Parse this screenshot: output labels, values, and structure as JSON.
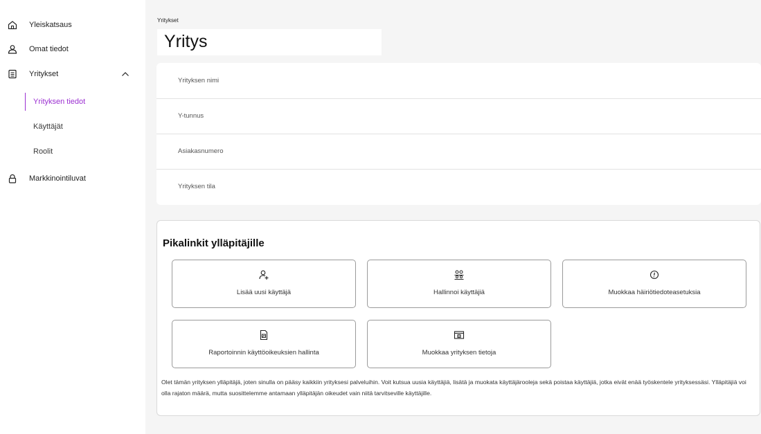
{
  "sidebar": {
    "items": [
      {
        "label": "Yleiskatsaus",
        "icon": "home-icon"
      },
      {
        "label": "Omat tiedot",
        "icon": "user-icon"
      },
      {
        "label": "Yritykset",
        "icon": "document-icon"
      },
      {
        "label": "Markkinointiluvat",
        "icon": "lock-icon"
      }
    ],
    "subitems": [
      {
        "label": "Yrityksen tiedot",
        "active": true
      },
      {
        "label": "Käyttäjät"
      },
      {
        "label": "Roolit"
      }
    ]
  },
  "breadcrumb": "Yritykset",
  "page_title": "Yritys",
  "fields": [
    {
      "label": "Yrityksen nimi"
    },
    {
      "label": "Y-tunnus"
    },
    {
      "label": "Asiakasnumero"
    },
    {
      "label": "Yrityksen tila"
    }
  ],
  "quick_links": {
    "title": "Pikalinkit ylläpitäjille",
    "buttons": [
      {
        "label": "Lisää uusi käyttäjä",
        "icon": "add-user-icon"
      },
      {
        "label": "Hallinnoi käyttäjiä",
        "icon": "users-icon"
      },
      {
        "label": "Muokkaa häiriötiedoteasetuksia",
        "icon": "alert-icon"
      },
      {
        "label": "Raportoinnin käyttöoikeuksien hallinta",
        "icon": "report-icon"
      },
      {
        "label": "Muokkaa yrityksen tietoja",
        "icon": "company-card-icon"
      }
    ],
    "description": "Olet tämän yrityksen ylläpitäjä, joten sinulla on pääsy kaikkiin yrityksesi palveluihin. Voit kutsua uusia käyttäjiä, lisätä ja muokata käyttäjärooleja sekä poistaa käyttäjiä, jotka eivät enää työskentele yrityksessäsi. Ylläpitäjiä voi olla rajaton määrä, mutta suosittelemme antamaan ylläpitäjän oikeudet vain niitä tarvitseville käyttäjille."
  },
  "colors": {
    "accent": "#9b2fd1",
    "background": "#f5f5f5"
  }
}
